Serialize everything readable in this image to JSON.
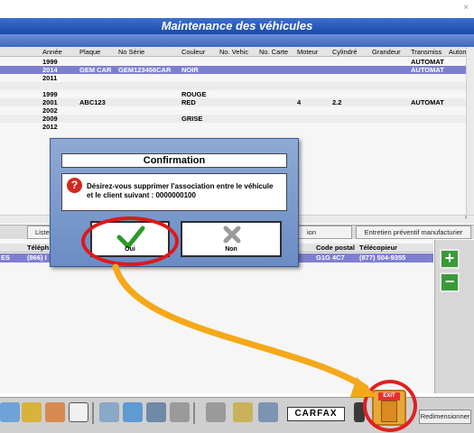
{
  "window": {
    "close_glyph": "×"
  },
  "title": "Maintenance des véhicules",
  "vehicle_table": {
    "columns": [
      "Année",
      "Plaque",
      "No Série",
      "Couleur",
      "No. Vehic",
      "No. Carte",
      "Moteur",
      "Cylindré",
      "Grandeur",
      "Transmiss",
      "Autom"
    ],
    "rows": [
      {
        "annee": "1999",
        "plaque": "",
        "serie": "",
        "couleur": "",
        "moteur": "",
        "cyl": "",
        "trans": "AUTOMAT"
      },
      {
        "annee": "2014",
        "plaque": "GEM CAR",
        "serie": "GEM123456CAR",
        "couleur": "NOIR",
        "moteur": "",
        "cyl": "",
        "trans": "AUTOMAT"
      },
      {
        "annee": "2011",
        "plaque": "",
        "serie": "",
        "couleur": "",
        "moteur": "",
        "cyl": "",
        "trans": ""
      },
      {
        "annee": "",
        "plaque": "",
        "serie": "",
        "couleur": "",
        "moteur": "",
        "cyl": "",
        "trans": ""
      },
      {
        "annee": "1999",
        "plaque": "",
        "serie": "",
        "couleur": "ROUGE",
        "moteur": "",
        "cyl": "",
        "trans": ""
      },
      {
        "annee": "2001",
        "plaque": "ABC123",
        "serie": "",
        "couleur": "RED",
        "moteur": "4",
        "cyl": "2.2",
        "trans": "AUTOMAT"
      },
      {
        "annee": "2002",
        "plaque": "",
        "serie": "",
        "couleur": "",
        "moteur": "",
        "cyl": "",
        "trans": ""
      },
      {
        "annee": "2009",
        "plaque": "",
        "serie": "",
        "couleur": "GRISE",
        "moteur": "",
        "cyl": "",
        "trans": ""
      },
      {
        "annee": "2012",
        "plaque": "",
        "serie": "",
        "couleur": "",
        "moteur": "",
        "cyl": "",
        "trans": ""
      }
    ]
  },
  "tabs": {
    "liste": "Liste d",
    "ion": "ion",
    "entretien": "Entretien préventif manufacturier"
  },
  "client_table": {
    "col_tel": "Téléph",
    "col_cp": "Code postal",
    "col_fax": "Télécopieur",
    "row": {
      "prefix": "ES",
      "tel": "(866) I",
      "cp": "G1G 4C7",
      "fax": "(877) 504-9355"
    }
  },
  "dialog": {
    "title": "Confirmation",
    "message": "Désirez-vous supprimer l'association entre le véhicule et le client suivant : 0000000100",
    "yes_label": "Oui",
    "no_label": "Non",
    "question_glyph": "?"
  },
  "toolbar": {
    "carfax": "CARFAX",
    "resize_label": "Redimensionner",
    "exit_label": "EXIT"
  },
  "colors": {
    "title_bar": "#1c49a8",
    "selection": "#7f7fd0",
    "highlight_circle": "#e01818",
    "arrow": "#f5a81a"
  }
}
